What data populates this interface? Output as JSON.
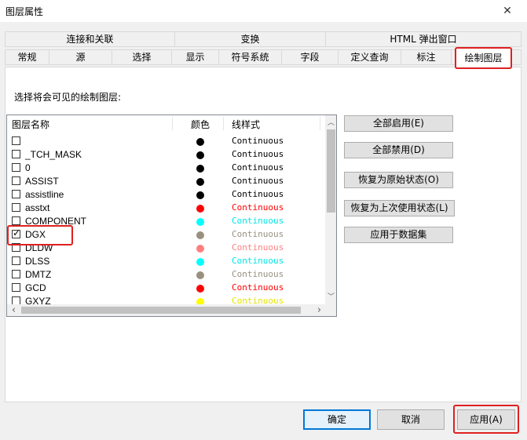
{
  "window": {
    "title": "图层属性",
    "close_glyph": "✕"
  },
  "tabs": {
    "row1": [
      "连接和关联",
      "变换",
      "HTML 弹出窗口"
    ],
    "row2": [
      "常规",
      "源",
      "选择",
      "显示",
      "符号系统",
      "字段",
      "定义查询",
      "标注"
    ],
    "selected": "绘制图层"
  },
  "prompt": "选择将会可见的绘制图层:",
  "columns": {
    "name": "图层名称",
    "color": "颜色",
    "linetype": "线样式"
  },
  "rows": [
    {
      "name": "",
      "checked": false,
      "color": "#000000",
      "linetype": "Continuous",
      "ltcolor": "#000000"
    },
    {
      "name": "_TCH_MASK",
      "checked": false,
      "color": "#000000",
      "linetype": "Continuous",
      "ltcolor": "#000000"
    },
    {
      "name": "0",
      "checked": false,
      "color": "#000000",
      "linetype": "Continuous",
      "ltcolor": "#000000"
    },
    {
      "name": "ASSIST",
      "checked": false,
      "color": "#000000",
      "linetype": "Continuous",
      "ltcolor": "#000000"
    },
    {
      "name": "assistline",
      "checked": false,
      "color": "#000000",
      "linetype": "Continuous",
      "ltcolor": "#000000"
    },
    {
      "name": "asstxt",
      "checked": false,
      "color": "#ff0000",
      "linetype": "Continuous",
      "ltcolor": "#ff0000"
    },
    {
      "name": "COMPONENT",
      "checked": false,
      "color": "#00ffff",
      "linetype": "Continuous",
      "ltcolor": "#00e5e5"
    },
    {
      "name": "DGX",
      "checked": true,
      "color": "#999080",
      "linetype": "Continuous",
      "ltcolor": "#999080"
    },
    {
      "name": "DLDW",
      "checked": false,
      "color": "#ff7f7f",
      "linetype": "Continuous",
      "ltcolor": "#ff7f7f"
    },
    {
      "name": "DLSS",
      "checked": false,
      "color": "#00ffff",
      "linetype": "Continuous",
      "ltcolor": "#00e5e5"
    },
    {
      "name": "DMTZ",
      "checked": false,
      "color": "#999080",
      "linetype": "Continuous",
      "ltcolor": "#999080"
    },
    {
      "name": "GCD",
      "checked": false,
      "color": "#ff0000",
      "linetype": "Continuous",
      "ltcolor": "#ff0000"
    },
    {
      "name": "GXYZ",
      "checked": false,
      "color": "#ffff00",
      "linetype": "Continuous",
      "ltcolor": "#e5e500"
    }
  ],
  "side_buttons": [
    "全部启用(E)",
    "全部禁用(D)",
    "恢复为原始状态(O)",
    "恢复为上次使用状态(L)",
    "应用于数据集"
  ],
  "footer": {
    "ok": "确定",
    "cancel": "取消",
    "apply": "应用(A)"
  },
  "scroll": {
    "up": "︿",
    "down": "﹀",
    "left": "‹",
    "right": "›"
  }
}
